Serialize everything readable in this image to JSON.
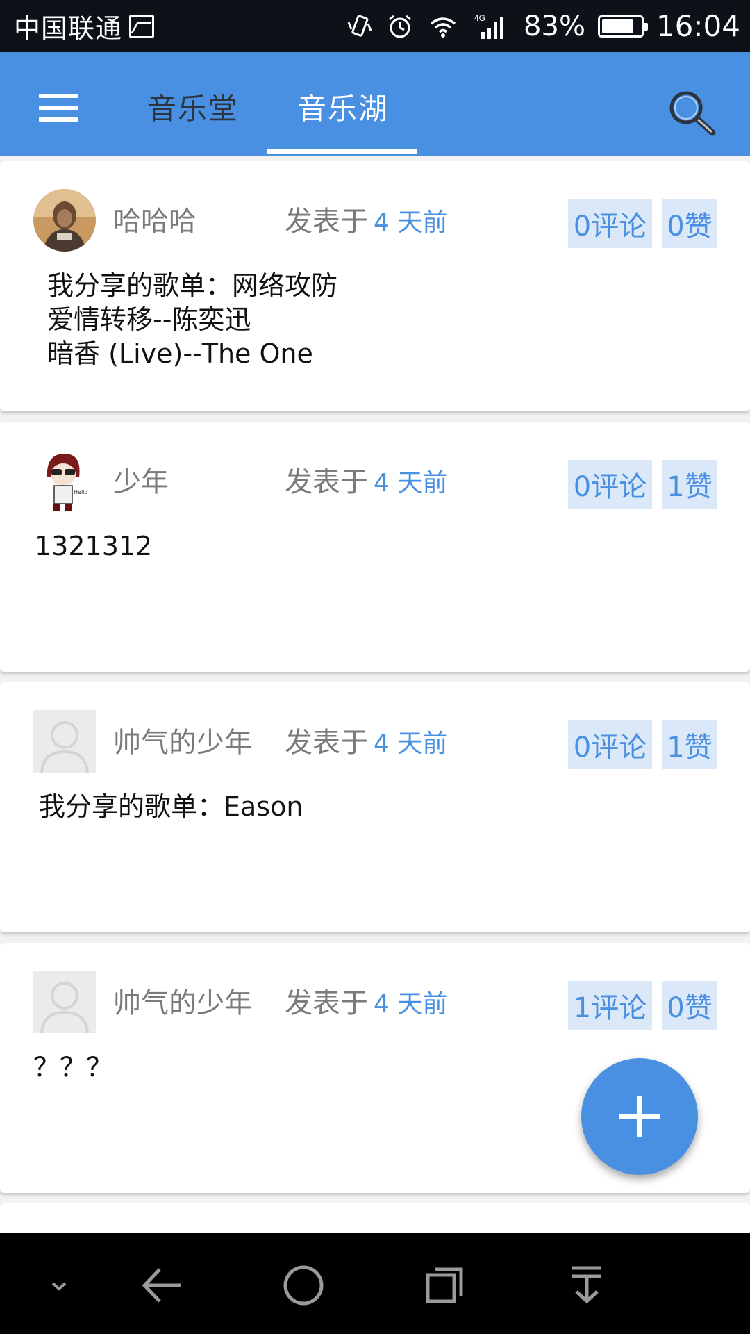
{
  "status_bar": {
    "carrier": "中国联通",
    "network": "4G",
    "battery_percent": "83%",
    "battery_level": 0.83,
    "time": "16:04",
    "icons": [
      "image-icon",
      "vibrate-icon",
      "alarm-icon",
      "wifi-icon",
      "signal-icon",
      "battery-icon"
    ]
  },
  "header": {
    "tabs": [
      {
        "label": "音乐堂",
        "active": false
      },
      {
        "label": "音乐湖",
        "active": true
      }
    ],
    "accent_color": "#4a90e2"
  },
  "posts": [
    {
      "username": "哈哈哈",
      "posted_prefix": "发表于",
      "posted_time": "4 天前",
      "comments": "0评论",
      "likes": "0赞",
      "content": "我分享的歌单：网络攻防\n爱情转移--陈奕迅\n暗香 (Live)--The One",
      "avatar": "photo-avatar"
    },
    {
      "username": "少年",
      "posted_prefix": "发表于",
      "posted_time": "4 天前",
      "comments": "0评论",
      "likes": "1赞",
      "content": "1321312",
      "avatar": "cartoon-avatar"
    },
    {
      "username": "帅气的少年",
      "posted_prefix": "发表于",
      "posted_time": "4 天前",
      "comments": "0评论",
      "likes": "1赞",
      "content": "我分享的歌单：Eason",
      "avatar": "default-avatar"
    },
    {
      "username": "帅气的少年",
      "posted_prefix": "发表于",
      "posted_time": "4 天前",
      "comments": "1评论",
      "likes": "0赞",
      "content": "？？？",
      "avatar": "default-avatar"
    }
  ],
  "fab": {
    "icon": "plus-icon"
  },
  "nav_bar": {
    "icons": [
      "collapse-icon",
      "back-icon",
      "home-icon",
      "recents-icon",
      "notification-pull-icon"
    ]
  }
}
